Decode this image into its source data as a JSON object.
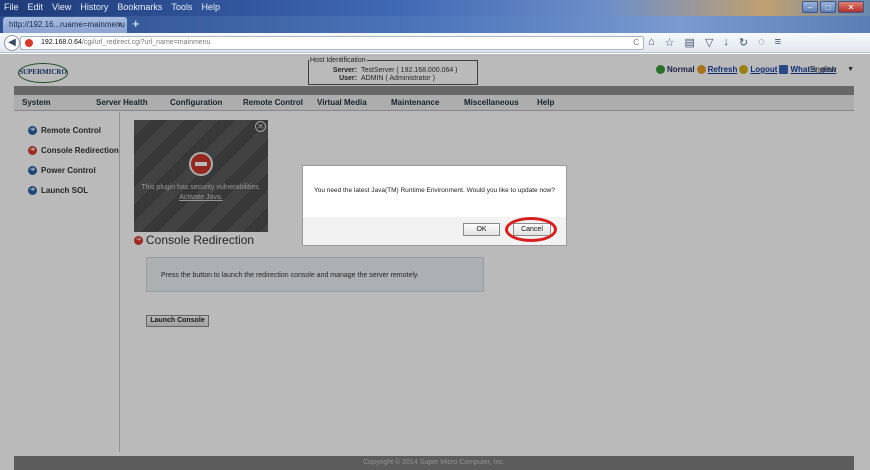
{
  "browser": {
    "menu": [
      "File",
      "Edit",
      "View",
      "History",
      "Bookmarks",
      "Tools",
      "Help"
    ],
    "tab_title": "http://192.16...ruame=mainmenu",
    "url_host": "192.168.0.64",
    "url_path": "/cgi/url_redirect.cgi?url_name=mainmenu"
  },
  "header": {
    "logo_text": "SUPERMICRO",
    "host_id_legend": "Host Identification",
    "server_label": "Server:",
    "server_value": "TestServer  ( 192.168.000.064 )",
    "user_label": "User:",
    "user_value": "ADMIN    ( Administrator )",
    "status": "Normal",
    "refresh": "Refresh",
    "logout": "Logout",
    "whats_new": "What's_new",
    "language": "English"
  },
  "nav": {
    "items": [
      "System",
      "Server Health",
      "Configuration",
      "Remote Control",
      "Virtual Media",
      "Maintenance",
      "Miscellaneous",
      "Help"
    ]
  },
  "sidebar": {
    "items": [
      "Remote Control",
      "Console Redirection",
      "Power Control",
      "Launch SOL"
    ]
  },
  "plugin": {
    "message": "This plugin has security vulnerabilities.",
    "activate": "Activate Java."
  },
  "main": {
    "title": "Console Redirection",
    "info": "Press the button to launch the redirection console and manage the server remotely.",
    "launch_button": "Launch Console"
  },
  "footer": {
    "copyright": "Copyright © 2014 Super Micro Computer, Inc."
  },
  "dialog": {
    "message": "You need the latest Java(TM) Runtime Environment. Would you like to update now?",
    "ok": "OK",
    "cancel": "Cancel"
  },
  "colors": {
    "highlight_ring": "#d62020",
    "nav_bar": "#ededed",
    "gray_stripe": "#8f8f8f"
  }
}
